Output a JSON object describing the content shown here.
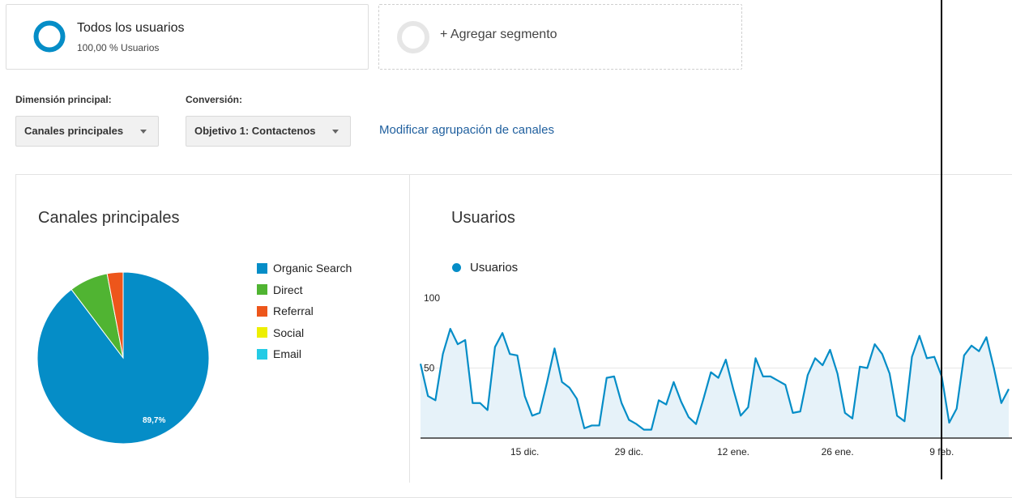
{
  "segments": {
    "all_users": {
      "title": "Todos los usuarios",
      "subtitle": "100,00 % Usuarios"
    },
    "add": {
      "label": "+ Agregar segmento"
    }
  },
  "controls": {
    "primary_dimension_label": "Dimensión principal:",
    "primary_dimension_value": "Canales principales",
    "conversion_label": "Conversión:",
    "conversion_value": "Objetivo 1: Contactenos",
    "modify_link": "Modificar agrupación de canales"
  },
  "pie_panel": {
    "title": "Canales principales",
    "legend": [
      {
        "label": "Organic Search",
        "color": "#058dc7"
      },
      {
        "label": "Direct",
        "color": "#50b432"
      },
      {
        "label": "Referral",
        "color": "#ed561b"
      },
      {
        "label": "Social",
        "color": "#edef00"
      },
      {
        "label": "Email",
        "color": "#24cbe5"
      }
    ]
  },
  "line_panel": {
    "title": "Usuarios",
    "legend_label": "Usuarios",
    "series_color": "#058dc7"
  },
  "chart_data": [
    {
      "type": "pie",
      "slices": [
        {
          "label": "Organic Search",
          "value": 89.7,
          "color": "#058dc7"
        },
        {
          "label": "Direct",
          "value": 7.3,
          "color": "#50b432"
        },
        {
          "label": "Referral",
          "value": 3.0,
          "color": "#ed561b"
        }
      ],
      "data_labels": [
        "89,7%"
      ]
    },
    {
      "type": "area",
      "y_ticks": [
        "100",
        "50"
      ],
      "ylim": [
        0,
        100
      ],
      "x_tick_labels": [
        "15 dic.",
        "29 dic.",
        "12 ene.",
        "26 ene.",
        "9 feb."
      ],
      "x_tick_indices": [
        14,
        28,
        42,
        56,
        70
      ],
      "series": [
        {
          "name": "Usuarios",
          "color": "#058dc7",
          "values": [
            53,
            30,
            27,
            60,
            78,
            67,
            70,
            25,
            25,
            20,
            65,
            75,
            60,
            59,
            30,
            16,
            18,
            40,
            64,
            40,
            36,
            28,
            7,
            9,
            9,
            43,
            44,
            25,
            13,
            10,
            6,
            6,
            27,
            24,
            40,
            26,
            15,
            10,
            28,
            47,
            43,
            56,
            35,
            16,
            22,
            57,
            44,
            44,
            41,
            38,
            18,
            19,
            45,
            57,
            52,
            63,
            46,
            18,
            14,
            51,
            50,
            67,
            60,
            46,
            16,
            12,
            58,
            73,
            57,
            58,
            44,
            11,
            21,
            59,
            66,
            62,
            72,
            50,
            25,
            35
          ]
        }
      ]
    }
  ]
}
